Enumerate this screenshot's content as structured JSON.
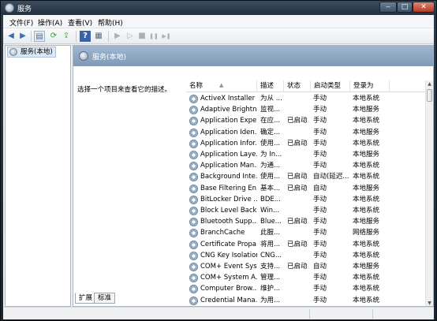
{
  "window": {
    "title": "服务",
    "min_label": "‒",
    "max_label": "□",
    "close_label": "✕"
  },
  "menu": [
    {
      "label": "文件(F)"
    },
    {
      "label": "操作(A)"
    },
    {
      "label": "查看(V)"
    },
    {
      "label": "帮助(H)"
    }
  ],
  "toolbar": {
    "back_icon": "◀",
    "forward_icon": "▶",
    "show_tree_icon": "▤",
    "refresh_icon": "⟳",
    "export_icon": "⇪",
    "help_icon": "?",
    "properties_icon": "▦",
    "start_icon": "▶",
    "start2_icon": "▷",
    "stop_icon": "■",
    "pause_icon": "❚❚",
    "restart_icon": "▶❚"
  },
  "tree": {
    "root_label": "服务(本地)"
  },
  "main": {
    "header_title": "服务(本地)",
    "description": "选择一个项目来查看它的描述。",
    "columns": {
      "name": "名称",
      "desc": "描述",
      "status": "状态",
      "start": "启动类型",
      "logon": "登录为"
    },
    "rows": [
      {
        "name": "ActiveX Installer ...",
        "desc": "为从 ...",
        "status": "",
        "start": "手动",
        "logon": "本地系统"
      },
      {
        "name": "Adaptive Brightn...",
        "desc": "监视...",
        "status": "",
        "start": "手动",
        "logon": "本地服务"
      },
      {
        "name": "Application Expe...",
        "desc": "在应...",
        "status": "已启动",
        "start": "手动",
        "logon": "本地系统"
      },
      {
        "name": "Application Iden...",
        "desc": "确定...",
        "status": "",
        "start": "手动",
        "logon": "本地服务"
      },
      {
        "name": "Application Infor...",
        "desc": "使用...",
        "status": "已启动",
        "start": "手动",
        "logon": "本地系统"
      },
      {
        "name": "Application Laye...",
        "desc": "为 In...",
        "status": "",
        "start": "手动",
        "logon": "本地服务"
      },
      {
        "name": "Application Man...",
        "desc": "为通...",
        "status": "",
        "start": "手动",
        "logon": "本地系统"
      },
      {
        "name": "Background Inte...",
        "desc": "使用...",
        "status": "已启动",
        "start": "自动(延迟...",
        "logon": "本地系统"
      },
      {
        "name": "Base Filtering En...",
        "desc": "基本...",
        "status": "已启动",
        "start": "自动",
        "logon": "本地服务"
      },
      {
        "name": "BitLocker Drive ...",
        "desc": "BDE...",
        "status": "",
        "start": "手动",
        "logon": "本地系统"
      },
      {
        "name": "Block Level Back...",
        "desc": "Win...",
        "status": "",
        "start": "手动",
        "logon": "本地系统"
      },
      {
        "name": "Bluetooth Supp...",
        "desc": "Blue...",
        "status": "已启动",
        "start": "手动",
        "logon": "本地服务"
      },
      {
        "name": "BranchCache",
        "desc": "此服...",
        "status": "",
        "start": "手动",
        "logon": "网络服务"
      },
      {
        "name": "Certificate Propa...",
        "desc": "将用...",
        "status": "已启动",
        "start": "手动",
        "logon": "本地系统"
      },
      {
        "name": "CNG Key Isolation",
        "desc": "CNG...",
        "status": "",
        "start": "手动",
        "logon": "本地系统"
      },
      {
        "name": "COM+ Event Sys...",
        "desc": "支持...",
        "status": "已启动",
        "start": "自动",
        "logon": "本地服务"
      },
      {
        "name": "COM+ System A...",
        "desc": "管理...",
        "status": "",
        "start": "手动",
        "logon": "本地系统"
      },
      {
        "name": "Computer Brow...",
        "desc": "维护...",
        "status": "",
        "start": "手动",
        "logon": "本地系统"
      },
      {
        "name": "Credential Mana...",
        "desc": "为用...",
        "status": "",
        "start": "手动",
        "logon": "本地系统"
      }
    ]
  },
  "tabs": [
    {
      "label": "扩展"
    },
    {
      "label": "标准"
    }
  ]
}
